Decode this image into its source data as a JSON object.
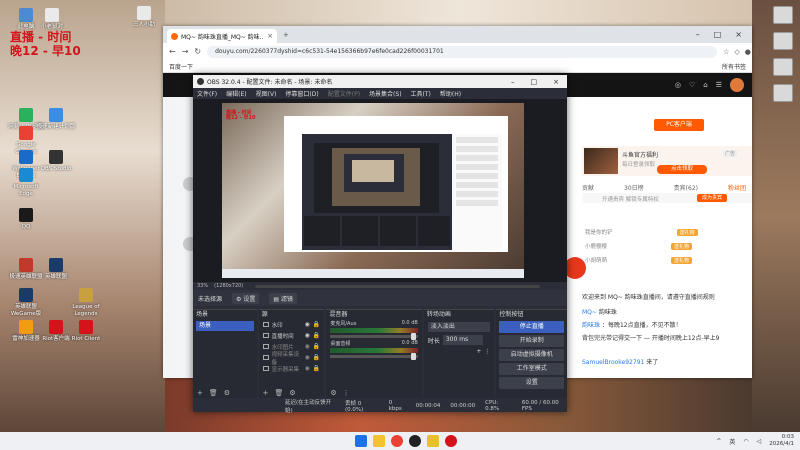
{
  "overlay": {
    "line1": "直播 - 时间",
    "line2": "晚12 - 早10"
  },
  "desktop_icons": [
    {
      "label": "此电脑",
      "color": "#4a8bd4"
    },
    {
      "label": "小老鼠对",
      "color": "#eaeaea"
    },
    {
      "label": "三人小助",
      "color": "#eaeaea"
    },
    {
      "label": "网易UU加速器",
      "color": "#2bb15c"
    },
    {
      "label": "Google Chrome",
      "color": "#e94235"
    },
    {
      "label": "极速新建计划版",
      "color": "#3a8ee6"
    },
    {
      "label": "Wallpaper Engine",
      "color": "#1a6bc7"
    },
    {
      "label": "Microsoft Edge",
      "color": "#1a8ad4"
    },
    {
      "label": "OBS Studio",
      "color": "#333333"
    },
    {
      "label": "QQ",
      "color": "#1a1a1a"
    },
    {
      "label": "极速英雄联盟",
      "color": "#c0392b"
    },
    {
      "label": "英雄联盟",
      "color": "#1a3a6a"
    },
    {
      "label": "英雄联盟WeGame版",
      "color": "#1a3a6a"
    },
    {
      "label": "League of Legends",
      "color": "#c8a040"
    },
    {
      "label": "雷神加速器",
      "color": "#f39c12"
    },
    {
      "label": "Riot客户端",
      "color": "#d4131a"
    },
    {
      "label": "Riot Client",
      "color": "#d4131a"
    }
  ],
  "browser": {
    "tab_title": "MQ~ 韵味珠直播_MQ~ 韵味...",
    "url": "douyu.com/2260377dyshid=c6c531-54e156366b97e6fe0cad226f00031701",
    "bookmark": "百度一下",
    "bookmarks_right": "所有书签",
    "pc_button": "PC客户端",
    "promo_title": "斗鱼官方福利",
    "promo_sub": "每日登录领取",
    "promo_btn": "点击领取",
    "promo_ad": "广告",
    "rank_tabs": [
      "贡献",
      "30日榜",
      "贵宾(62)",
      "粉丝团"
    ],
    "rank_line": "开通贵宾 解锁专属特权",
    "rank_btn": "成为贵宾",
    "chat_items": [
      {
        "name": "我是你的铲",
        "gift": "送礼物"
      },
      {
        "name": "小鹿樱樱",
        "gift": "送礼物"
      },
      {
        "name": "小胡萌萌",
        "gift": "送礼物"
      }
    ],
    "chat_msgs": [
      {
        "user": "",
        "text": "欢迎来到 MQ~ 韵味珠直播间，请遵守直播间规则"
      },
      {
        "user": "MQ~",
        "text": "韵味珠"
      },
      {
        "user": "韵味珠",
        "text": "：每晚12点直播，不见不散！"
      },
      {
        "user": "",
        "text": "背包完光带记得交一下 — 开播时间晚上12点-早上9"
      },
      {
        "user": "SamuelBrooke92791",
        "text": "来了"
      }
    ]
  },
  "obs": {
    "title": "OBS 32.0.4 - 配置文件: 未命名 - 场景: 未命名",
    "menu": [
      "文件(F)",
      "编辑(E)",
      "视图(V)",
      "停靠窗口(D)",
      "配置文件(P)",
      "场景集合(S)",
      "工具(T)",
      "帮助(H)"
    ],
    "zoom": "33%",
    "resolution": "(1280x720)",
    "no_source": "未选择源",
    "props_btn": "设置",
    "filters_btn": "滤镜",
    "docks": {
      "scenes": "场景",
      "sources": "源",
      "mixer": "混音器",
      "transitions": "转场动画",
      "controls": "控制按钮"
    },
    "scene": "场景",
    "sources": [
      "水印",
      "直播时间",
      "水印图片",
      "视频采集设备",
      "显示器采集"
    ],
    "mixer": [
      {
        "name": "麦克风/Aux",
        "db": "0.0 dB"
      },
      {
        "name": "桌面音频",
        "db": "0.0 dB"
      }
    ],
    "transition": "淡入淡出",
    "duration_label": "时长",
    "duration": "300 ms",
    "controls": [
      "停止直播",
      "开始录制",
      "启动虚拟摄像机",
      "工作室模式",
      "设置"
    ],
    "status": {
      "delay": "延迟(在主动反馈开始)",
      "dropped": "丢帧 0 (0.0%)",
      "bitrate": "0 kbps",
      "time": "00:00:04",
      "rec": "00:00:00",
      "cpu": "CPU: 0.8%",
      "fps": "60.00 / 60.00 FPS"
    }
  },
  "taskbar": {
    "lang": "英",
    "time": "0:03",
    "date": "2026/4/1"
  }
}
